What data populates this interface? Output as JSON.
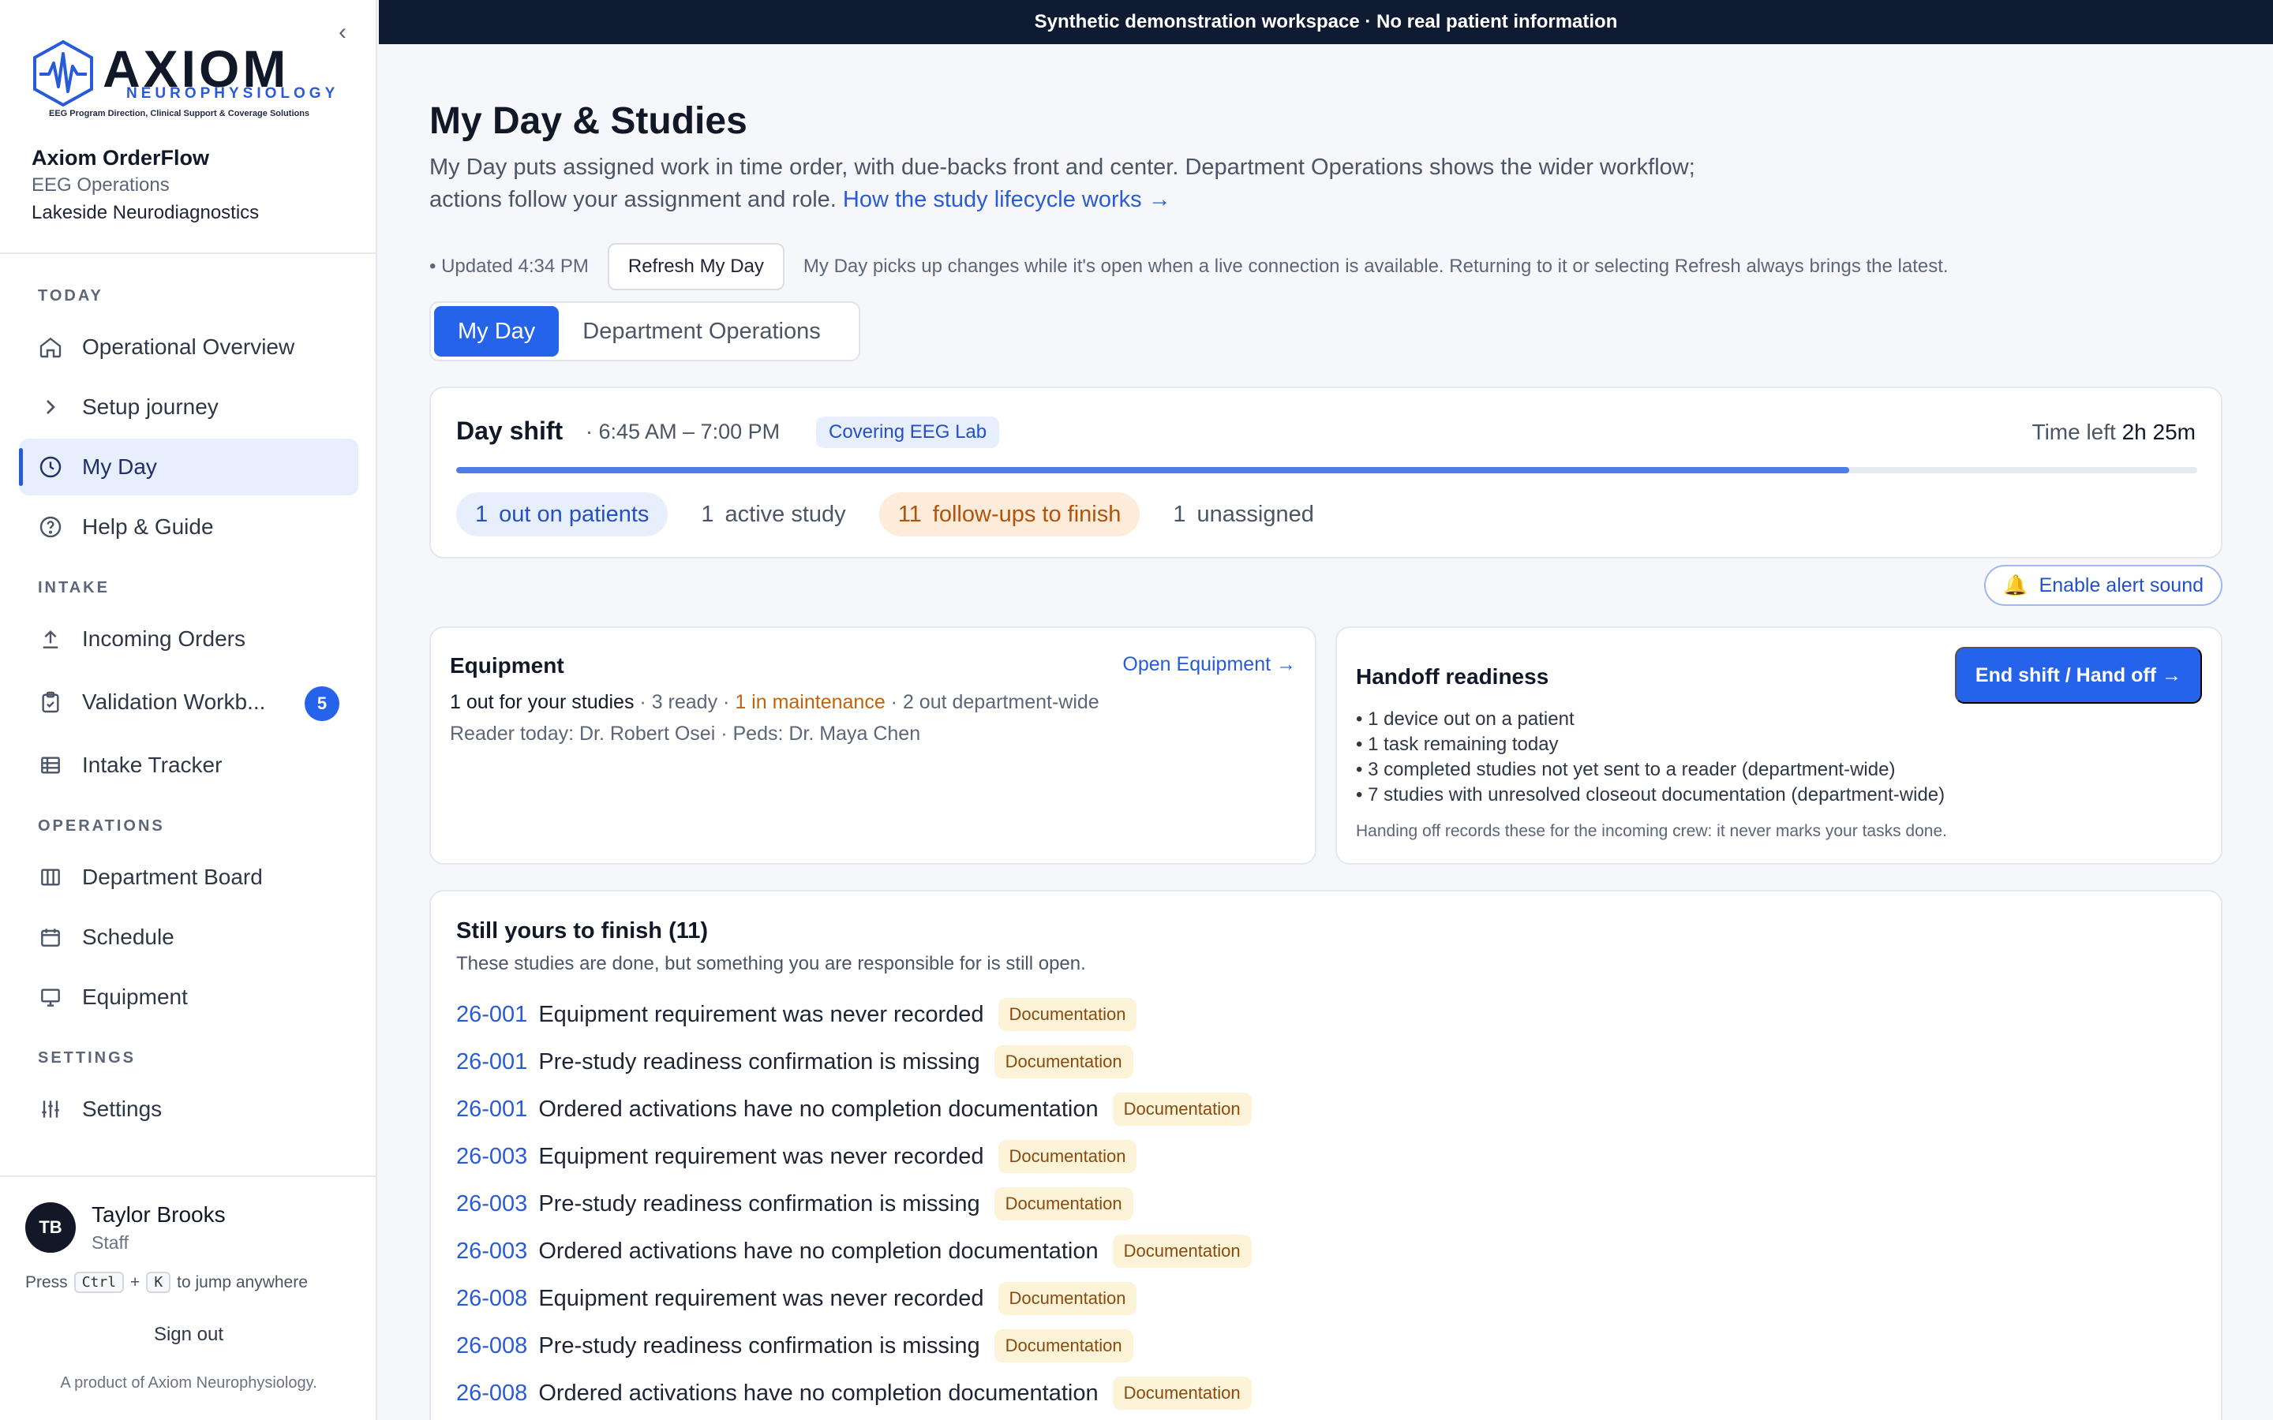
{
  "banner": "Synthetic demonstration workspace · No real patient information",
  "brand": {
    "wordmark": "AXIOM",
    "sub": "NEUROPHYSIOLOGY",
    "tagline": "EEG Program Direction, Clinical Support & Coverage Solutions",
    "app": "Axiom OrderFlow",
    "dept": "EEG Operations",
    "site": "Lakeside Neurodiagnostics",
    "accent": "#2a5bd7"
  },
  "sidebar": {
    "sections": {
      "today": "TODAY",
      "intake": "INTAKE",
      "operations": "OPERATIONS",
      "settings": "SETTINGS"
    },
    "items": [
      {
        "label": "Operational Overview",
        "icon": "home-icon"
      },
      {
        "label": "Setup journey",
        "icon": "chevron-right-icon"
      },
      {
        "label": "My Day",
        "icon": "clock-icon",
        "active": true
      },
      {
        "label": "Help & Guide",
        "icon": "help-icon"
      },
      {
        "label": "Incoming Orders",
        "icon": "upload-icon"
      },
      {
        "label": "Validation Workb...",
        "icon": "clipboard-check-icon",
        "badge": "5"
      },
      {
        "label": "Intake Tracker",
        "icon": "table-icon"
      },
      {
        "label": "Department Board",
        "icon": "columns-icon"
      },
      {
        "label": "Schedule",
        "icon": "calendar-icon"
      },
      {
        "label": "Equipment",
        "icon": "monitor-icon"
      },
      {
        "label": "Settings",
        "icon": "sliders-icon"
      }
    ]
  },
  "user": {
    "initials": "TB",
    "name": "Taylor Brooks",
    "role": "Staff",
    "shortcut_prefix": "Press",
    "key1": "Ctrl",
    "plus": "+",
    "key2": "K",
    "shortcut_suffix": "to jump anywhere",
    "sign_out": "Sign out",
    "product": "A product of Axiom Neurophysiology."
  },
  "page": {
    "title": "My Day & Studies",
    "desc": "My Day puts assigned work in time order, with due-backs front and center. Department Operations shows the wider workflow; actions follow your assignment and role.",
    "desc_link": "How the study lifecycle works →",
    "updated": "• Updated 4:34 PM",
    "refresh_label": "Refresh My Day",
    "refresh_note": "My Day picks up changes while it's open when a live connection is available. Returning to it or selecting Refresh always brings the latest.",
    "tabs": [
      "My Day",
      "Department Operations"
    ]
  },
  "shift": {
    "title": "Day shift",
    "time": "· 6:45 AM – 7:00 PM",
    "chip": "Covering EEG Lab",
    "time_left_label": "Time left",
    "time_left": "2h 25m",
    "progress": 0.8,
    "stats": [
      {
        "n": "1",
        "label": "out on patients",
        "style": "blue"
      },
      {
        "n": "1",
        "label": "active study",
        "style": "plain"
      },
      {
        "n": "11",
        "label": "follow-ups to finish",
        "style": "orange"
      },
      {
        "n": "1",
        "label": "unassigned",
        "style": "plain"
      }
    ]
  },
  "alert_sound": "Enable alert sound",
  "equipment": {
    "title": "Equipment",
    "link": "Open Equipment →",
    "out_for_you": "1 out for your studies",
    "ready": "· 3 ready ·",
    "maintenance": "1 in maintenance",
    "dept_out": "· 2 out department-wide",
    "readers": "Reader today: Dr. Robert Osei · Peds: Dr. Maya Chen"
  },
  "handoff": {
    "title": "Handoff readiness",
    "button": "End shift / Hand off →",
    "items": [
      "1 device out on a patient",
      "1 task remaining today",
      "3 completed studies not yet sent to a reader (department-wide)",
      "7 studies with unresolved closeout documentation (department-wide)"
    ],
    "footnote": "Handing off records these for the incoming crew: it never marks your tasks done."
  },
  "finish": {
    "title": "Still yours to finish (11)",
    "subtitle": "These studies are done, but something you are responsible for is still open.",
    "rows": [
      {
        "id": "26-001",
        "text": "Equipment requirement was never recorded",
        "tag": "Documentation"
      },
      {
        "id": "26-001",
        "text": "Pre-study readiness confirmation is missing",
        "tag": "Documentation"
      },
      {
        "id": "26-001",
        "text": "Ordered activations have no completion documentation",
        "tag": "Documentation"
      },
      {
        "id": "26-003",
        "text": "Equipment requirement was never recorded",
        "tag": "Documentation"
      },
      {
        "id": "26-003",
        "text": "Pre-study readiness confirmation is missing",
        "tag": "Documentation"
      },
      {
        "id": "26-003",
        "text": "Ordered activations have no completion documentation",
        "tag": "Documentation"
      },
      {
        "id": "26-008",
        "text": "Equipment requirement was never recorded",
        "tag": "Documentation"
      },
      {
        "id": "26-008",
        "text": "Pre-study readiness confirmation is missing",
        "tag": "Documentation"
      },
      {
        "id": "26-008",
        "text": "Ordered activations have no completion documentation",
        "tag": "Documentation"
      }
    ]
  }
}
